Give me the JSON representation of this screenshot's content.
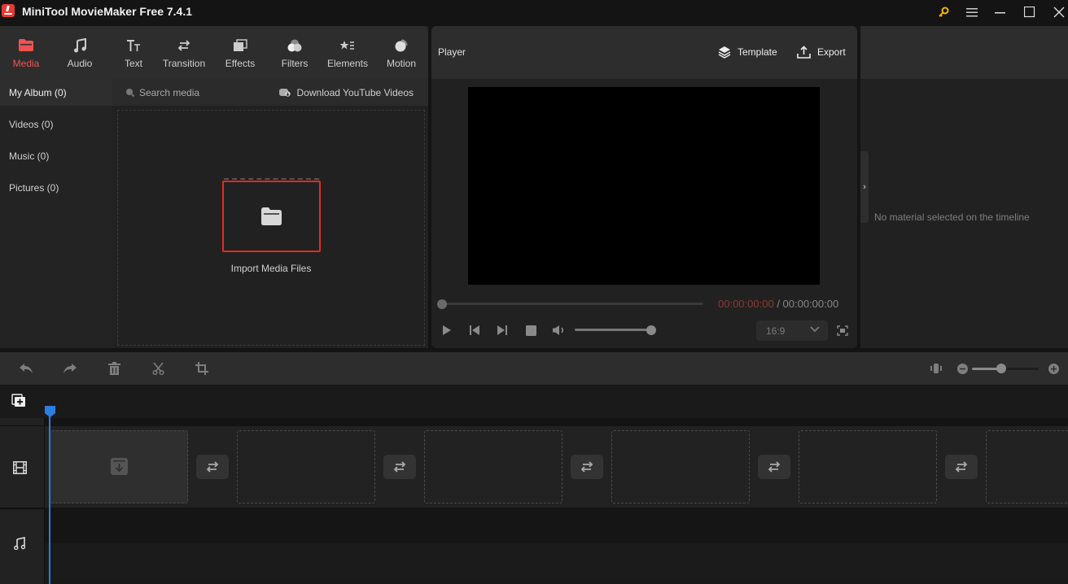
{
  "window": {
    "title": "MiniTool MovieMaker Free 7.4.1",
    "controls": [
      "key-icon",
      "menu-icon",
      "minimize-icon",
      "maximize-icon",
      "close-icon"
    ]
  },
  "toolbar": {
    "tabs": [
      {
        "label": "Media",
        "icon": "folder-icon",
        "active": true
      },
      {
        "label": "Audio",
        "icon": "music-icon",
        "active": false
      },
      {
        "label": "Text",
        "icon": "text-icon",
        "active": false
      },
      {
        "label": "Transition",
        "icon": "transition-icon",
        "active": false
      },
      {
        "label": "Effects",
        "icon": "effects-icon",
        "active": false
      },
      {
        "label": "Filters",
        "icon": "filters-icon",
        "active": false
      },
      {
        "label": "Elements",
        "icon": "elements-icon",
        "active": false
      },
      {
        "label": "Motion",
        "icon": "motion-icon",
        "active": false
      }
    ],
    "active_color": "#ef5350"
  },
  "sidebar": {
    "items": [
      {
        "label": "My Album (0)",
        "selected": true
      },
      {
        "label": "Videos (0)",
        "selected": false
      },
      {
        "label": "Music (0)",
        "selected": false
      },
      {
        "label": "Pictures (0)",
        "selected": false
      }
    ]
  },
  "media": {
    "search_placeholder": "Search media",
    "download_label": "Download YouTube Videos",
    "import_label": "Import Media Files"
  },
  "player": {
    "title": "Player",
    "template_label": "Template",
    "export_label": "Export",
    "current_time": "00:00:00:00",
    "total_time": "/ 00:00:00:00",
    "seek_progress": 0,
    "volume": 1.0,
    "aspect_ratio": "16:9"
  },
  "properties": {
    "empty_message": "No material selected on the timeline"
  },
  "timeline": {
    "tools": [
      "undo-icon",
      "redo-icon",
      "delete-icon",
      "split-icon",
      "crop-icon"
    ],
    "zoom_level": 0.45,
    "clip_slots": 6,
    "accent": "#2b7de0"
  }
}
